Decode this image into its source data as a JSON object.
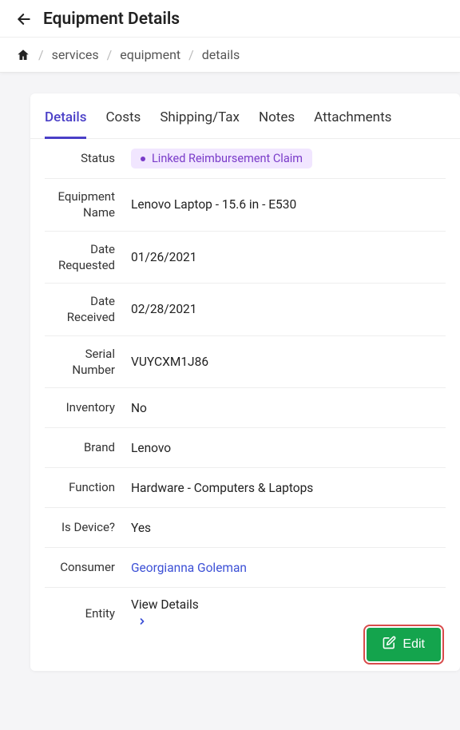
{
  "header": {
    "title": "Equipment Details"
  },
  "breadcrumbs": {
    "items": [
      "services",
      "equipment",
      "details"
    ]
  },
  "tabs": {
    "items": [
      {
        "label": "Details",
        "active": true
      },
      {
        "label": "Costs"
      },
      {
        "label": "Shipping/Tax"
      },
      {
        "label": "Notes"
      },
      {
        "label": "Attachments"
      }
    ]
  },
  "fields": {
    "status": {
      "label": "Status",
      "badge": "Linked Reimbursement Claim"
    },
    "equipment_name": {
      "label": "Equipment Name",
      "value": "Lenovo Laptop - 15.6 in - E530"
    },
    "date_requested": {
      "label": "Date Requested",
      "value": "01/26/2021"
    },
    "date_received": {
      "label": "Date Received",
      "value": "02/28/2021"
    },
    "serial_number": {
      "label": "Serial Number",
      "value": "VUYCXM1J86"
    },
    "inventory": {
      "label": "Inventory",
      "value": "No"
    },
    "brand": {
      "label": "Brand",
      "value": "Lenovo"
    },
    "function": {
      "label": "Function",
      "value": "Hardware - Computers & Laptops"
    },
    "is_device": {
      "label": "Is Device?",
      "value": "Yes"
    },
    "consumer": {
      "label": "Consumer",
      "value": "Georgianna Goleman"
    },
    "entity": {
      "label": "Entity",
      "value": "View Details"
    }
  },
  "actions": {
    "edit": "Edit"
  }
}
